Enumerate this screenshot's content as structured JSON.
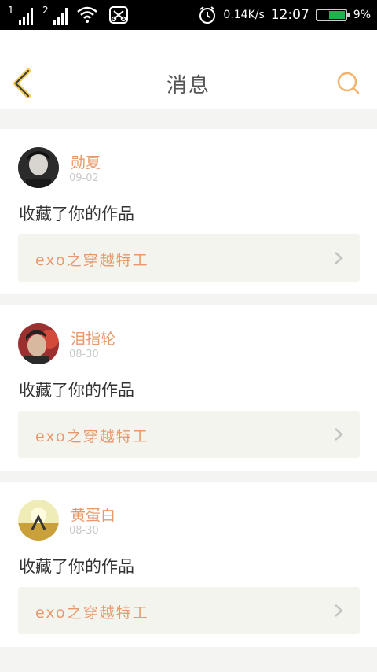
{
  "status_bar": {
    "sim1_label": "1",
    "sim2_label": "2",
    "net_speed": "0.14K/s",
    "time": "12:07",
    "battery": "9%"
  },
  "header": {
    "title": "消息",
    "back_icon": "chevron-left-icon",
    "search_icon": "search-icon",
    "accent_color": "#f2b36b"
  },
  "notifications": [
    {
      "username": "勋夏",
      "date": "09-02",
      "action": "收藏了你的作品",
      "work_title": "exo之穿越特工"
    },
    {
      "username": "泪指轮",
      "date": "08-30",
      "action": "收藏了你的作品",
      "work_title": "exo之穿越特工"
    },
    {
      "username": "黄蛋白",
      "date": "08-30",
      "action": "收藏了你的作品",
      "work_title": "exo之穿越特工"
    }
  ],
  "colors": {
    "username": "#e9986b",
    "date": "#c9c9c9",
    "link_bg": "#f4f4ee",
    "page_bg": "#f4f4f2"
  }
}
